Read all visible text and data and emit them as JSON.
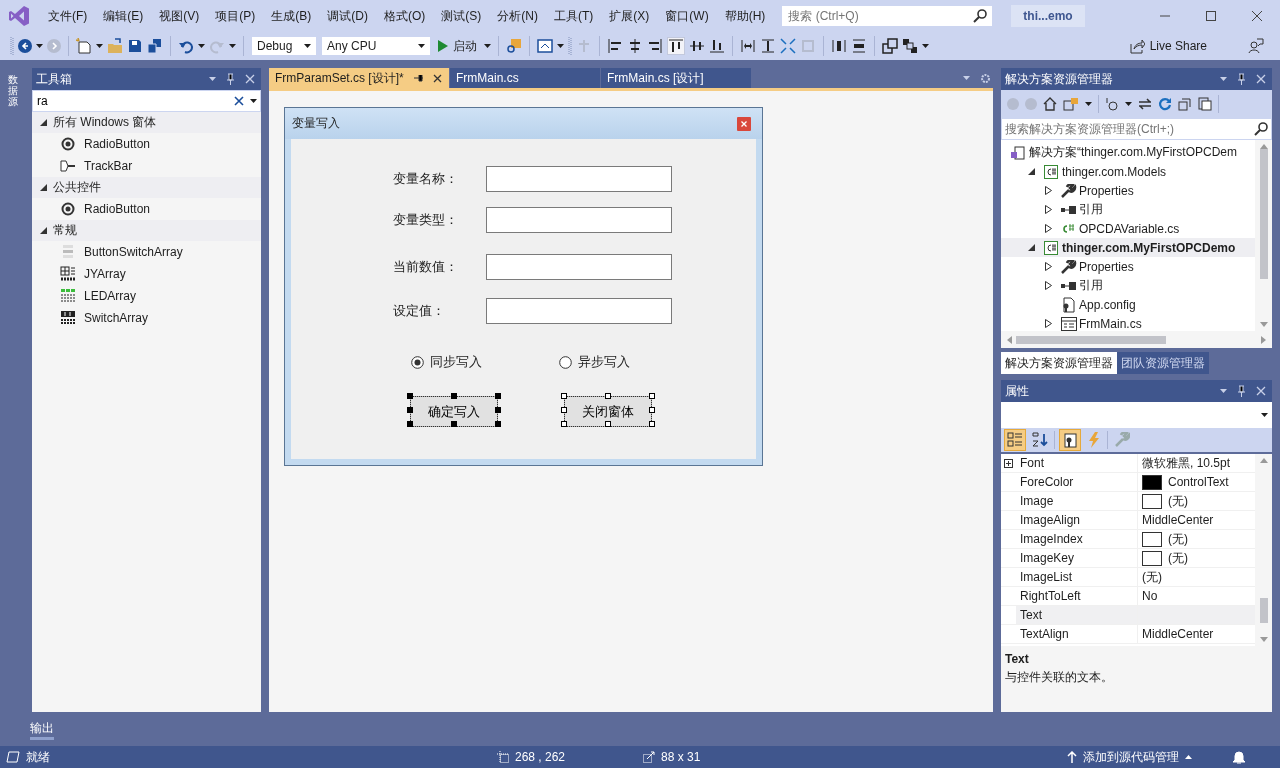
{
  "menu": [
    "文件(F)",
    "编辑(E)",
    "视图(V)",
    "项目(P)",
    "生成(B)",
    "调试(D)",
    "格式(O)",
    "测试(S)",
    "分析(N)",
    "工具(T)",
    "扩展(X)",
    "窗口(W)",
    "帮助(H)"
  ],
  "search": {
    "placeholder": "搜索 (Ctrl+Q)"
  },
  "solution_badge": "thi...emo",
  "toolbar": {
    "configuration": "Debug",
    "platform": "Any CPU",
    "start": "启动",
    "live_share": "Live Share"
  },
  "side_tab": "数据源",
  "toolbox": {
    "title": "工具箱",
    "search": "ra",
    "groups": [
      {
        "label": "所有 Windows 窗体",
        "expanded": true,
        "items": [
          {
            "label": "RadioButton",
            "kind": "radio"
          },
          {
            "label": "TrackBar",
            "kind": "trackbar"
          }
        ]
      },
      {
        "label": "公共控件",
        "expanded": true,
        "items": [
          {
            "label": "RadioButton",
            "kind": "radio"
          }
        ]
      },
      {
        "label": "常规",
        "expanded": true,
        "items": [
          {
            "label": "ButtonSwitchArray",
            "kind": "buttonswitch"
          },
          {
            "label": "JYArray",
            "kind": "jy"
          },
          {
            "label": "LEDArray",
            "kind": "led"
          },
          {
            "label": "SwitchArray",
            "kind": "switch"
          }
        ]
      }
    ]
  },
  "document_tabs": [
    {
      "label": "FrmParamSet.cs [设计]*",
      "selected": true
    },
    {
      "label": "FrmMain.cs",
      "selected": false
    },
    {
      "label": "FrmMain.cs [设计]",
      "selected": false
    }
  ],
  "form": {
    "title": "变量写入",
    "fields": [
      {
        "label": "变量名称："
      },
      {
        "label": "变量类型："
      },
      {
        "label": "当前数值："
      },
      {
        "label": "设定值："
      }
    ],
    "radios": [
      {
        "label": "同步写入",
        "selected": true
      },
      {
        "label": "异步写入",
        "selected": false
      }
    ],
    "buttons": [
      {
        "label": "确定写入",
        "primary": true
      },
      {
        "label": "关闭窗体",
        "primary": false
      }
    ]
  },
  "solution_explorer": {
    "title": "解决方案资源管理器",
    "search": {
      "placeholder": "搜索解决方案资源管理器(Ctrl+;)"
    },
    "tree": [
      {
        "label": "解决方案“thinger.com.MyFirstOPCDem",
        "kind": "solution",
        "bold": false,
        "selected": false,
        "children": [
          {
            "label": "thinger.com.Models",
            "kind": "project",
            "bold": false,
            "selected": false,
            "expanded": true,
            "children": [
              {
                "label": "Properties",
                "kind": "properties",
                "bold": false,
                "selected": false,
                "expanded": false
              },
              {
                "label": "引用",
                "kind": "references",
                "bold": false,
                "selected": false,
                "expanded": false
              },
              {
                "label": "OPCDAVariable.cs",
                "kind": "csfile",
                "bold": false,
                "selected": false,
                "expanded": false
              }
            ]
          },
          {
            "label": "thinger.com.MyFirstOPCDemo",
            "kind": "project",
            "bold": true,
            "selected": true,
            "expanded": true,
            "children": [
              {
                "label": "Properties",
                "kind": "properties",
                "bold": false,
                "selected": false,
                "expanded": false
              },
              {
                "label": "引用",
                "kind": "references",
                "bold": false,
                "selected": false,
                "expanded": false
              },
              {
                "label": "App.config",
                "kind": "config",
                "bold": false,
                "selected": false
              },
              {
                "label": "FrmMain.cs",
                "kind": "formfile",
                "bold": false,
                "selected": false,
                "expanded": false
              }
            ]
          }
        ]
      }
    ],
    "tabs": [
      {
        "label": "解决方案资源管理器",
        "selected": true
      },
      {
        "label": "团队资源管理器",
        "selected": false
      }
    ]
  },
  "properties": {
    "title": "属性",
    "rows": [
      {
        "name": "Font",
        "value": "微软雅黑, 10.5pt",
        "expandable": true,
        "selected": false
      },
      {
        "name": "ForeColor",
        "value": "ControlText",
        "color": "#000000",
        "selected": false
      },
      {
        "name": "Image",
        "value": "(无)",
        "color": "#ffffff",
        "selected": false
      },
      {
        "name": "ImageAlign",
        "value": "MiddleCenter",
        "selected": false
      },
      {
        "name": "ImageIndex",
        "value": "(无)",
        "color": "#ffffff",
        "selected": false
      },
      {
        "name": "ImageKey",
        "value": "(无)",
        "color": "#ffffff",
        "selected": false
      },
      {
        "name": "ImageList",
        "value": "(无)",
        "selected": false
      },
      {
        "name": "RightToLeft",
        "value": "No",
        "selected": false
      },
      {
        "name": "Text",
        "selected": true
      },
      {
        "name": "TextAlign",
        "value": "MiddleCenter",
        "selected": false
      }
    ],
    "description": {
      "title": "Text",
      "text": "与控件关联的文本。"
    }
  },
  "output_tab": "输出",
  "status_bar": {
    "message": "就绪",
    "position": "268 , 262",
    "size": "88 x 31",
    "source_control": "添加到源代码管理"
  }
}
